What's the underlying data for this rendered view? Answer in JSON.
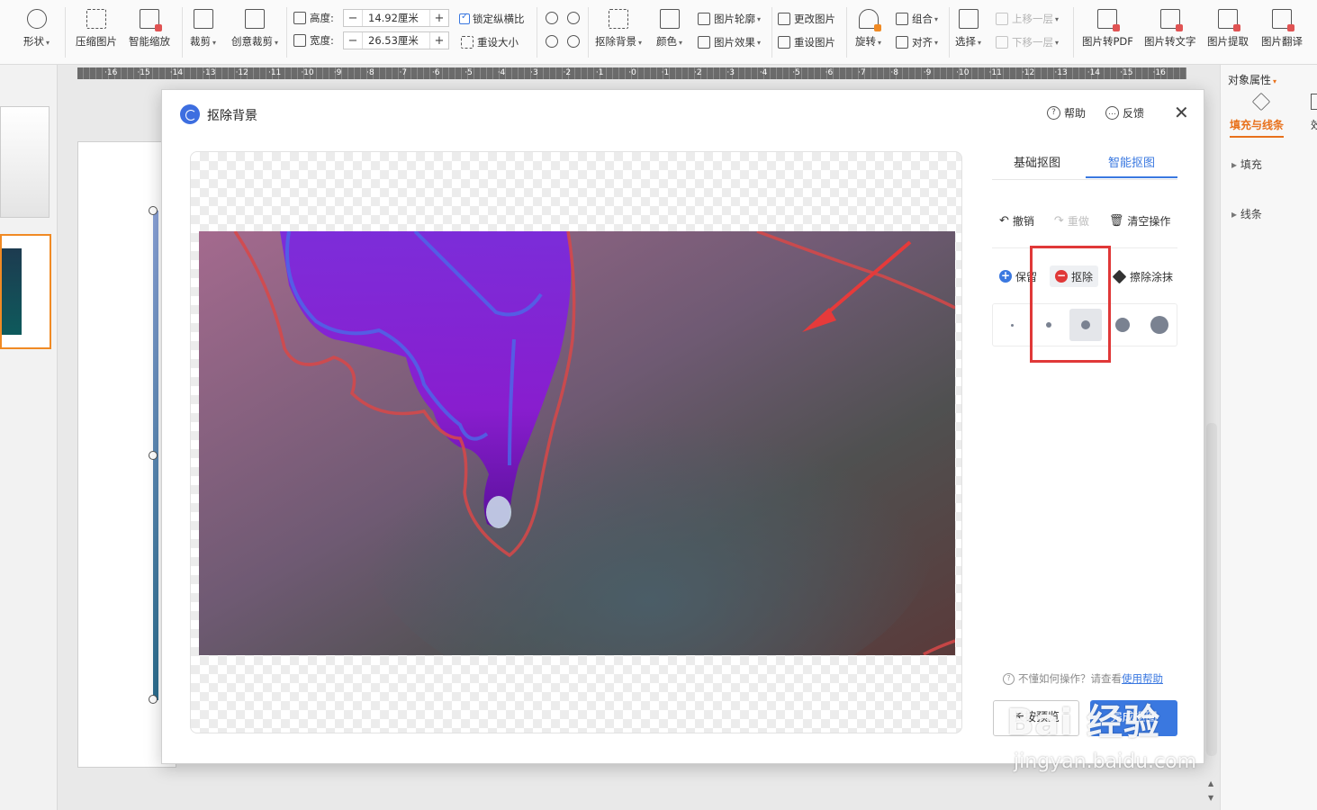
{
  "ribbon": {
    "shape": "形状",
    "compress": "压缩图片",
    "smart_zoom": "智能缩放",
    "crop": "裁剪",
    "creative_crop": "创意裁剪",
    "height_label": "高度:",
    "height_value": "14.92厘米",
    "width_label": "宽度:",
    "width_value": "26.53厘米",
    "lock_ratio": "锁定纵横比",
    "reset_size": "重设大小",
    "remove_bg": "抠除背景",
    "color": "颜色",
    "outline": "图片轮廓",
    "effects": "图片效果",
    "change_pic": "更改图片",
    "reset_pic": "重设图片",
    "rotate": "旋转",
    "group": "组合",
    "align": "对齐",
    "select": "选择",
    "bring_forward": "上移一层",
    "send_backward": "下移一层",
    "to_pdf": "图片转PDF",
    "to_text": "图片转文字",
    "extract": "图片提取",
    "translate": "图片翻译",
    "spin_minus": "−",
    "spin_plus": "+"
  },
  "ruler": [
    "16",
    "15",
    "14",
    "13",
    "12",
    "11",
    "10",
    "9",
    "8",
    "7",
    "6",
    "5",
    "4",
    "3",
    "2",
    "1",
    "0",
    "1",
    "2",
    "3",
    "4",
    "5",
    "6",
    "7",
    "8",
    "9",
    "10",
    "11",
    "12",
    "13",
    "14",
    "15",
    "16"
  ],
  "right_pane": {
    "title": "对象属性",
    "tab_fill_line": "填充与线条",
    "tab_effect": "效",
    "section_fill": "填充",
    "section_line": "线条"
  },
  "dialog": {
    "title": "抠除背景",
    "help": "帮助",
    "feedback": "反馈",
    "close": "✕",
    "tab_basic": "基础抠图",
    "tab_smart": "智能抠图",
    "undo": "撤销",
    "redo": "重做",
    "clear": "清空操作",
    "keep": "保留",
    "remove": "抠除",
    "erase": "擦除涂抹",
    "hint_text": "不懂如何操作？请查看",
    "hint_link": "使用帮助",
    "preview": "长按预览",
    "done": "完成抠图"
  },
  "watermark": {
    "brand": "Bai  经验",
    "url": "jingyan.baidu.com"
  },
  "colors": {
    "accent": "#3a78e0",
    "highlight_box": "#e03838",
    "keep_icon": "#3a78e0",
    "remove_icon": "#e03838"
  }
}
